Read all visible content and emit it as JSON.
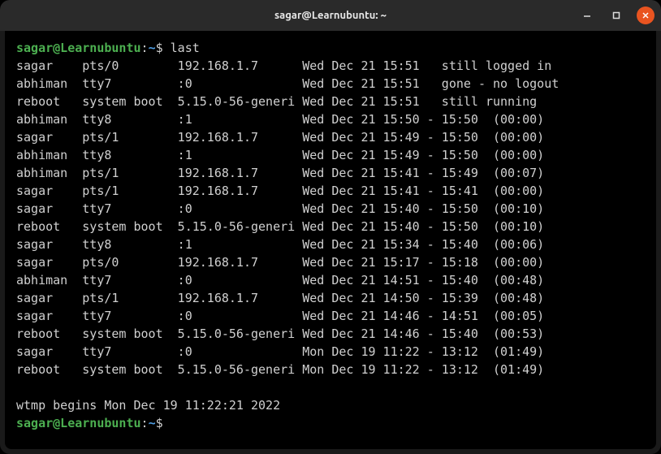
{
  "window": {
    "title": "sagar@Learnubuntu: ~"
  },
  "prompt": {
    "user_host": "sagar@Learnubuntu",
    "path": "~",
    "symbol": "$"
  },
  "command": "last",
  "entries": [
    {
      "user": "sagar",
      "tty": "pts/0",
      "from": "192.168.1.7",
      "login": "Wed Dec 21 15:51",
      "end": "still logged in",
      "duration": ""
    },
    {
      "user": "abhiman",
      "tty": "tty7",
      "from": ":0",
      "login": "Wed Dec 21 15:51",
      "end": "gone - no logout",
      "duration": ""
    },
    {
      "user": "reboot",
      "tty": "system boot",
      "from": "5.15.0-56-generi",
      "login": "Wed Dec 21 15:51",
      "end": "still running",
      "duration": ""
    },
    {
      "user": "abhiman",
      "tty": "tty8",
      "from": ":1",
      "login": "Wed Dec 21 15:50",
      "end": "15:50",
      "duration": "(00:00)"
    },
    {
      "user": "sagar",
      "tty": "pts/1",
      "from": "192.168.1.7",
      "login": "Wed Dec 21 15:49",
      "end": "15:50",
      "duration": "(00:00)"
    },
    {
      "user": "abhiman",
      "tty": "tty8",
      "from": ":1",
      "login": "Wed Dec 21 15:49",
      "end": "15:50",
      "duration": "(00:00)"
    },
    {
      "user": "abhiman",
      "tty": "pts/1",
      "from": "192.168.1.7",
      "login": "Wed Dec 21 15:41",
      "end": "15:49",
      "duration": "(00:07)"
    },
    {
      "user": "sagar",
      "tty": "pts/1",
      "from": "192.168.1.7",
      "login": "Wed Dec 21 15:41",
      "end": "15:41",
      "duration": "(00:00)"
    },
    {
      "user": "sagar",
      "tty": "tty7",
      "from": ":0",
      "login": "Wed Dec 21 15:40",
      "end": "15:50",
      "duration": "(00:10)"
    },
    {
      "user": "reboot",
      "tty": "system boot",
      "from": "5.15.0-56-generi",
      "login": "Wed Dec 21 15:40",
      "end": "15:50",
      "duration": "(00:10)"
    },
    {
      "user": "sagar",
      "tty": "tty8",
      "from": ":1",
      "login": "Wed Dec 21 15:34",
      "end": "15:40",
      "duration": "(00:06)"
    },
    {
      "user": "sagar",
      "tty": "pts/0",
      "from": "192.168.1.7",
      "login": "Wed Dec 21 15:17",
      "end": "15:18",
      "duration": "(00:00)"
    },
    {
      "user": "abhiman",
      "tty": "tty7",
      "from": ":0",
      "login": "Wed Dec 21 14:51",
      "end": "15:40",
      "duration": "(00:48)"
    },
    {
      "user": "sagar",
      "tty": "pts/1",
      "from": "192.168.1.7",
      "login": "Wed Dec 21 14:50",
      "end": "15:39",
      "duration": "(00:48)"
    },
    {
      "user": "sagar",
      "tty": "tty7",
      "from": ":0",
      "login": "Wed Dec 21 14:46",
      "end": "14:51",
      "duration": "(00:05)"
    },
    {
      "user": "reboot",
      "tty": "system boot",
      "from": "5.15.0-56-generi",
      "login": "Wed Dec 21 14:46",
      "end": "15:40",
      "duration": "(00:53)"
    },
    {
      "user": "sagar",
      "tty": "tty7",
      "from": ":0",
      "login": "Mon Dec 19 11:22",
      "end": "13:12",
      "duration": "(01:49)"
    },
    {
      "user": "reboot",
      "tty": "system boot",
      "from": "5.15.0-56-generi",
      "login": "Mon Dec 19 11:22",
      "end": "13:12",
      "duration": "(01:49)"
    }
  ],
  "footer": "wtmp begins Mon Dec 19 11:22:21 2022"
}
